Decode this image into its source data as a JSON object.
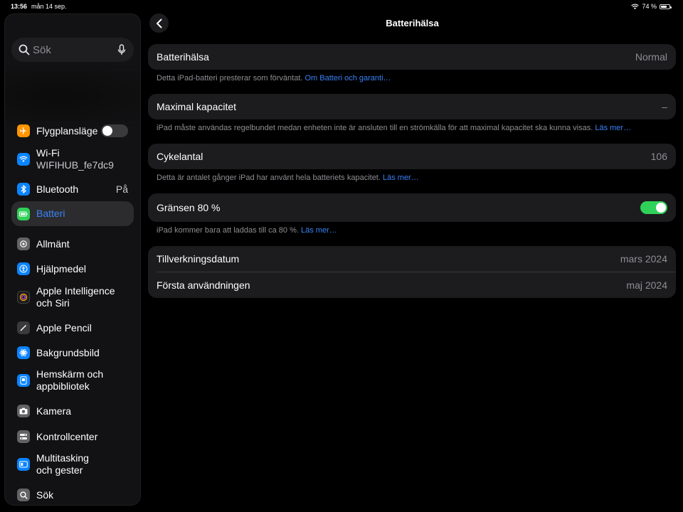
{
  "status": {
    "time": "13:56",
    "date": "mån 14 sep.",
    "battery_pct": "74 %",
    "battery_level": 0.74
  },
  "search": {
    "placeholder": "Sök"
  },
  "sidebar": {
    "items": [
      {
        "label": "Flygplansläge",
        "icon": "airplane-icon",
        "toggle": "off"
      },
      {
        "label": "Wi-Fi",
        "sub": "WIFIHUB_fe7dc9",
        "icon": "wifi-icon"
      },
      {
        "label": "Bluetooth",
        "value": "På",
        "icon": "bluetooth-icon"
      },
      {
        "label": "Batteri",
        "icon": "battery-icon",
        "active": true
      },
      {
        "label": "Allmänt",
        "icon": "gear-icon"
      },
      {
        "label": "Hjälpmedel",
        "icon": "accessibility-icon"
      },
      {
        "label": "Apple Intelligence",
        "sub": "och Siri",
        "icon": "siri-icon"
      },
      {
        "label": "Apple Pencil",
        "icon": "pencil-icon"
      },
      {
        "label": "Bakgrundsbild",
        "icon": "wallpaper-icon"
      },
      {
        "label": "Hemskärm och",
        "sub": "appbibliotek",
        "icon": "homescreen-icon"
      },
      {
        "label": "Kamera",
        "icon": "camera-icon"
      },
      {
        "label": "Kontrollcenter",
        "icon": "control-center-icon"
      },
      {
        "label": "Multitasking",
        "sub": "och gester",
        "icon": "multitasking-icon"
      },
      {
        "label": "Sök",
        "icon": "search-icon"
      }
    ]
  },
  "main": {
    "title": "Batterihälsa",
    "health": {
      "label": "Batterihälsa",
      "value": "Normal"
    },
    "health_note": {
      "text": "Detta iPad-batteri presterar som förväntat. ",
      "link": "Om Batteri och garanti…"
    },
    "capacity": {
      "label": "Maximal kapacitet",
      "value": "–"
    },
    "capacity_note": {
      "text": "iPad måste användas regelbundet medan enheten inte är ansluten till en strömkälla för att maximal kapacitet ska kunna visas. ",
      "link": "Läs mer…"
    },
    "cycles": {
      "label": "Cykelantal",
      "value": "106"
    },
    "cycles_note": {
      "text": "Detta är antalet gånger iPad har använt hela batteriets kapacitet. ",
      "link": "Läs mer…"
    },
    "limit": {
      "label": "Gränsen 80 %",
      "toggle": "on"
    },
    "limit_note": {
      "text": "iPad kommer bara att laddas till ca 80 %. ",
      "link": "Läs mer…"
    },
    "manufactured": {
      "label": "Tillverkningsdatum",
      "value": "mars 2024"
    },
    "first_use": {
      "label": "Första användningen",
      "value": "maj 2024"
    }
  },
  "colors": {
    "accent": "#3a82f7",
    "toggle_on": "#30d158",
    "card": "#1c1c1e"
  }
}
